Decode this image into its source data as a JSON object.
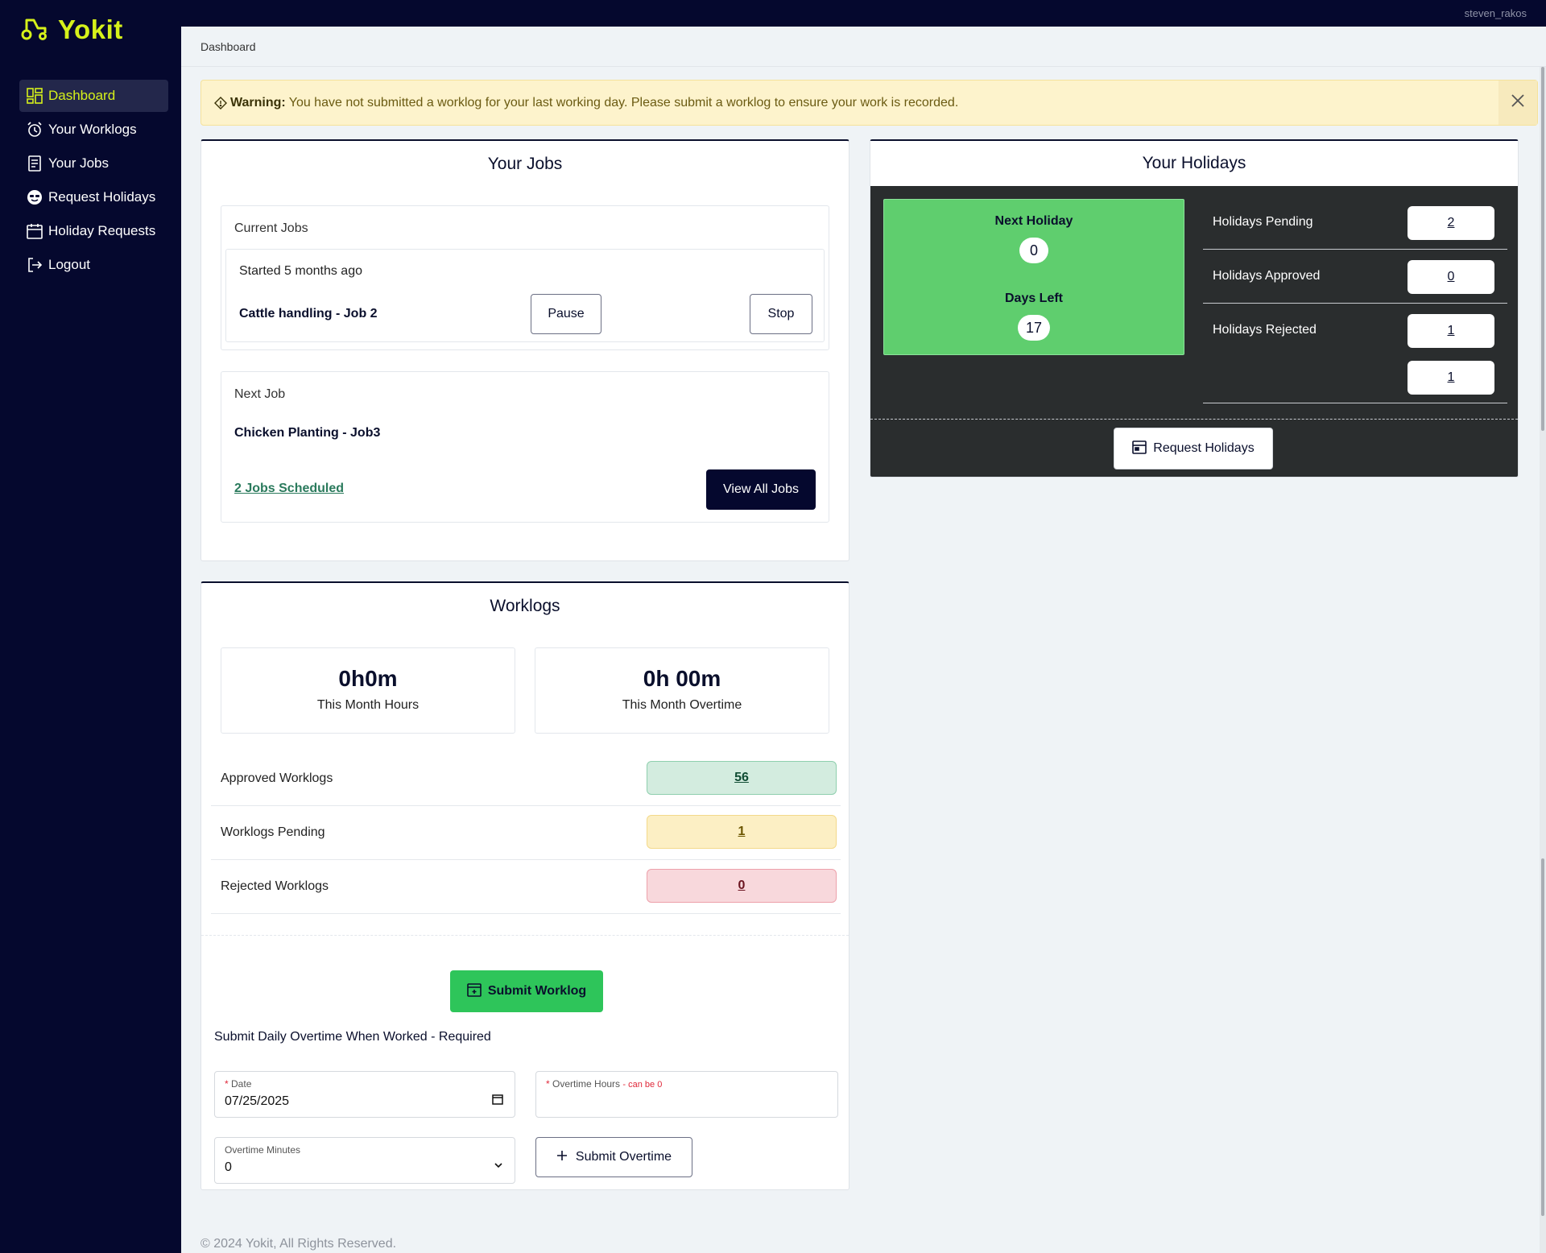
{
  "app": {
    "brand": "Yokit",
    "username": "steven_rakos"
  },
  "sidebar": {
    "items": [
      {
        "label": "Dashboard",
        "icon": "dashboard-icon"
      },
      {
        "label": "Your Worklogs",
        "icon": "alarm-clock-icon"
      },
      {
        "label": "Your Jobs",
        "icon": "document-list-icon"
      },
      {
        "label": "Request Holidays",
        "icon": "smiley-sunglasses-icon"
      },
      {
        "label": "Holiday Requests",
        "icon": "calendar-icon"
      },
      {
        "label": "Logout",
        "icon": "logout-icon"
      }
    ]
  },
  "breadcrumb": "Dashboard",
  "warning": {
    "title": "Warning:",
    "message": "You have not submitted a worklog for your last working day. Please submit a worklog to ensure your work is recorded."
  },
  "jobs": {
    "title": "Your Jobs",
    "current_label": "Current Jobs",
    "started": "Started 5 months ago",
    "current_job": "Cattle handling - Job 2",
    "pause": "Pause",
    "stop": "Stop",
    "next_label": "Next Job",
    "next_job": "Chicken Planting - Job3",
    "scheduled_link": "2 Jobs Scheduled",
    "view_all": "View All Jobs"
  },
  "holidays": {
    "title": "Your Holidays",
    "next_holiday_label": "Next Holiday",
    "next_holiday_value": "0",
    "days_left_label": "Days Left",
    "days_left_value": "17",
    "pending_label": "Holidays Pending",
    "pending_value": "2",
    "approved_label": "Holidays Approved",
    "approved_value": "0",
    "rejected_label": "Holidays Rejected",
    "rejected_value": "1",
    "extra_value": "1",
    "request_button": "Request Holidays"
  },
  "worklogs": {
    "title": "Worklogs",
    "month_hours": "0h0m",
    "month_hours_label": "This Month Hours",
    "month_overtime": "0h 00m",
    "month_overtime_label": "This Month Overtime",
    "approved_label": "Approved Worklogs",
    "approved_value": "56",
    "pending_label": "Worklogs Pending",
    "pending_value": "1",
    "rejected_label": "Rejected Worklogs",
    "rejected_value": "0",
    "submit_button": "Submit Worklog",
    "overtime_title": "Submit Daily Overtime When Worked - Required",
    "date_label": "Date",
    "date_value": "07/25/2025",
    "ot_hours_label": "Overtime Hours",
    "ot_hours_hint": "- can be 0",
    "ot_minutes_label": "Overtime Minutes",
    "ot_minutes_value": "0",
    "submit_overtime": "Submit Overtime"
  },
  "footer": "© 2024 Yokit, All Rights Reserved.",
  "colors": {
    "sidebar_bg": "#05082e",
    "accent": "#d6f11a",
    "success": "#2ec55a",
    "holiday_green": "#5fce6e",
    "warning_bg": "#fdf3cc"
  }
}
